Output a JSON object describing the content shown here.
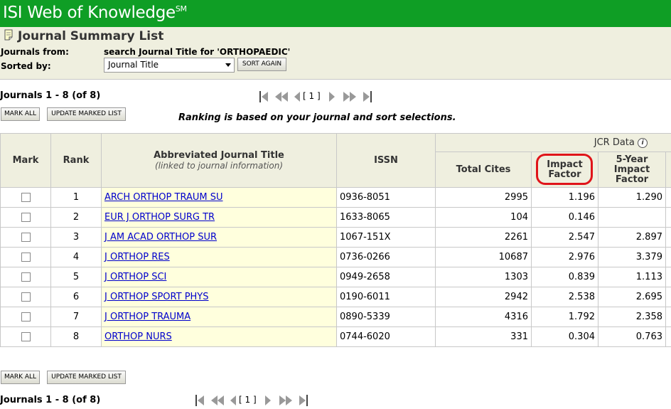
{
  "header": {
    "title": "ISI Web of Knowledge",
    "mark": "SM"
  },
  "page": {
    "title": "Journal Summary List"
  },
  "info": {
    "journals_from_label": "Journals from:",
    "journals_from_value": "search Journal Title for 'ORTHOPAEDIC'",
    "sorted_by_label": "Sorted by:",
    "sort_value": "Journal Title",
    "sort_again_label": "SORT AGAIN"
  },
  "toolbar": {
    "count_text": "Journals 1 - 8 (of 8)",
    "mark_all_label": "MARK ALL",
    "update_label": "UPDATE MARKED LIST",
    "page_indicator": "[ 1 ]"
  },
  "ranking_note": "Ranking is based on your journal and sort selections.",
  "table": {
    "headers": {
      "mark": "Mark",
      "rank": "Rank",
      "title": "Abbreviated Journal Title",
      "title_sub": "(linked to journal information)",
      "issn": "ISSN",
      "jcr_group": "JCR Data",
      "total_cites": "Total Cites",
      "impact_factor": "Impact Factor",
      "five_year": "5-Year Impact Factor"
    },
    "rows": [
      {
        "rank": "1",
        "title": "ARCH ORTHOP TRAUM SU",
        "issn": "0936-8051",
        "total_cites": "2995",
        "impact_factor": "1.196",
        "five_year": "1.290"
      },
      {
        "rank": "2",
        "title": "EUR J ORTHOP SURG TR",
        "issn": "1633-8065",
        "total_cites": "104",
        "impact_factor": "0.146",
        "five_year": ""
      },
      {
        "rank": "3",
        "title": "J AM ACAD ORTHOP SUR",
        "issn": "1067-151X",
        "total_cites": "2261",
        "impact_factor": "2.547",
        "five_year": "2.897"
      },
      {
        "rank": "4",
        "title": "J ORTHOP RES",
        "issn": "0736-0266",
        "total_cites": "10687",
        "impact_factor": "2.976",
        "five_year": "3.379"
      },
      {
        "rank": "5",
        "title": "J ORTHOP SCI",
        "issn": "0949-2658",
        "total_cites": "1303",
        "impact_factor": "0.839",
        "five_year": "1.113"
      },
      {
        "rank": "6",
        "title": "J ORTHOP SPORT PHYS",
        "issn": "0190-6011",
        "total_cites": "2942",
        "impact_factor": "2.538",
        "five_year": "2.695"
      },
      {
        "rank": "7",
        "title": "J ORTHOP TRAUMA",
        "issn": "0890-5339",
        "total_cites": "4316",
        "impact_factor": "1.792",
        "five_year": "2.358"
      },
      {
        "rank": "8",
        "title": "ORTHOP NURS",
        "issn": "0744-6020",
        "total_cites": "331",
        "impact_factor": "0.304",
        "five_year": "0.763"
      }
    ]
  },
  "colors": {
    "header_green": "#0f9e25",
    "header_bg": "#efefdf",
    "title_cell_bg": "#ffffdd",
    "link": "#0000cc",
    "highlight": "#e0141a"
  },
  "icons": {
    "note": "note-icon",
    "first": "first-page-icon",
    "prev": "prev-page-icon",
    "next": "next-page-icon",
    "last": "last-page-icon",
    "info": "info-icon"
  }
}
